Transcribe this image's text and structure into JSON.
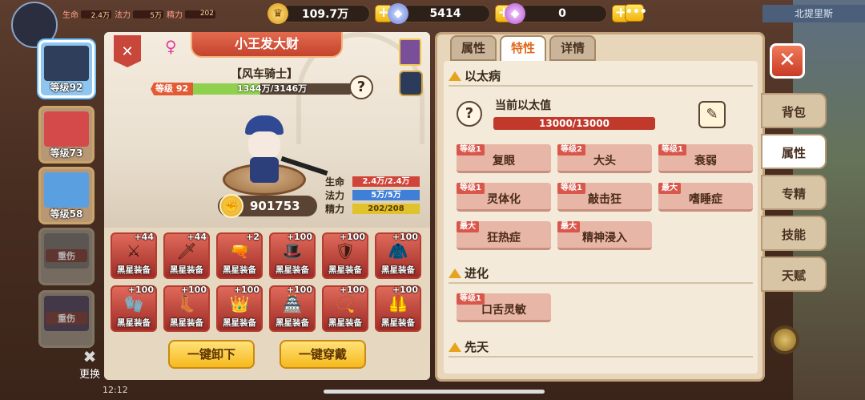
{
  "topbar": {
    "mini_stats": [
      {
        "label": "生命",
        "value": "2.4万"
      },
      {
        "label": "法力",
        "value": "5万"
      },
      {
        "label": "精力",
        "value": "202"
      }
    ],
    "gold": "109.7万",
    "diamond": "5414",
    "gem": "0",
    "region": "北提里斯"
  },
  "heroes": [
    {
      "level": "等级92",
      "active": true
    },
    {
      "level": "等级73",
      "active": false
    },
    {
      "level": "等级58",
      "active": false
    },
    {
      "status": "重伤"
    },
    {
      "status": "重伤"
    }
  ],
  "swap_label": "更换",
  "hero": {
    "name": "小王发大财",
    "title": "【风车骑士】",
    "level": "等级 92",
    "exp": "1344万/3146万",
    "exp_ratio": 0.427,
    "power": "901753",
    "stats": [
      {
        "label": "生命",
        "value": "2.4万/2.4万"
      },
      {
        "label": "法力",
        "value": "5万/5万"
      },
      {
        "label": "精力",
        "value": "202/208"
      }
    ]
  },
  "equipment": [
    {
      "lv": "+44",
      "tag": "黑星装备",
      "icon": "⚔"
    },
    {
      "lv": "+44",
      "tag": "黑星装备",
      "icon": "🗡"
    },
    {
      "lv": "+2",
      "tag": "黑星装备",
      "icon": "🔫"
    },
    {
      "lv": "+100",
      "tag": "黑星装备",
      "icon": "🎩"
    },
    {
      "lv": "+100",
      "tag": "黑星装备",
      "icon": "🛡"
    },
    {
      "lv": "+100",
      "tag": "黑星装备",
      "icon": "🧥"
    },
    {
      "lv": "+100",
      "tag": "黑星装备",
      "icon": "🧤"
    },
    {
      "lv": "+100",
      "tag": "黑星装备",
      "icon": "👢"
    },
    {
      "lv": "+100",
      "tag": "黑星装备",
      "icon": "👑"
    },
    {
      "lv": "+100",
      "tag": "黑星装备",
      "icon": "🏯"
    },
    {
      "lv": "+100",
      "tag": "黑星装备",
      "icon": "📿"
    },
    {
      "lv": "+100",
      "tag": "黑星装备",
      "icon": "🦺"
    }
  ],
  "buttons": {
    "unequip_all": "一键卸下",
    "equip_all": "一键穿戴"
  },
  "tabs": [
    "属性",
    "特性",
    "详情"
  ],
  "active_tab": 1,
  "sections": {
    "ether": {
      "title": "以太病",
      "current_label": "当前以太值",
      "current_value": "13000/13000",
      "traits": [
        {
          "lvl": "等级1",
          "name": "复眼"
        },
        {
          "lvl": "等级2",
          "name": "大头"
        },
        {
          "lvl": "等级1",
          "name": "衰弱"
        },
        {
          "lvl": "等级1",
          "name": "灵体化"
        },
        {
          "lvl": "等级1",
          "name": "敲击狂"
        },
        {
          "lvl": "最大",
          "name": "嗜睡症"
        },
        {
          "lvl": "最大",
          "name": "狂热症"
        },
        {
          "lvl": "最大",
          "name": "精神浸入"
        }
      ]
    },
    "evolution": {
      "title": "进化",
      "traits": [
        {
          "lvl": "等级1",
          "name": "口舌灵敏"
        }
      ]
    },
    "innate": {
      "title": "先天"
    }
  },
  "side_nav": [
    "背包",
    "属性",
    "专精",
    "技能",
    "天赋"
  ],
  "side_nav_active": 1,
  "clock": "12:12"
}
